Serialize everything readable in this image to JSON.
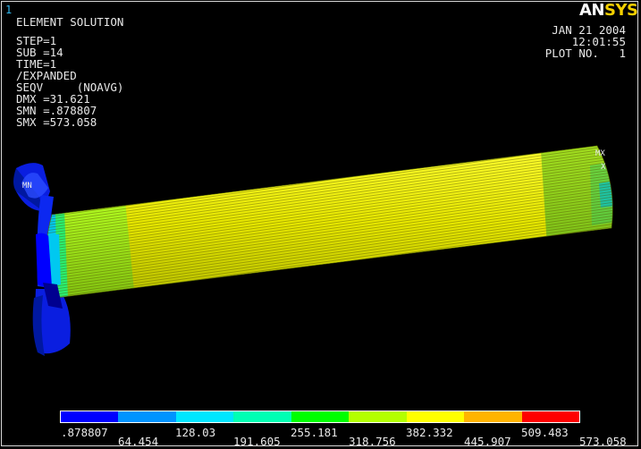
{
  "window_number": "1",
  "brand": {
    "part1": "AN",
    "part2": "SYS"
  },
  "header_left": [
    "ELEMENT SOLUTION",
    "",
    "STEP=1",
    "SUB =14",
    "TIME=1",
    "/EXPANDED",
    "SEQV     (NOAVG)",
    "DMX =31.621",
    "SMN =.878807",
    "SMX =573.058"
  ],
  "header_right": {
    "date": "JAN 21 2004",
    "time": "12:01:55",
    "plot": "PLOT NO.   1"
  },
  "markers": {
    "min": "MN",
    "max": "MX"
  },
  "legend": {
    "colors": [
      "#0000ff",
      "#0094ff",
      "#00e6ff",
      "#00ffb4",
      "#00ff00",
      "#b4ff00",
      "#ffff00",
      "#ffb400",
      "#ff0000"
    ],
    "labels_top_row": [
      ".878807",
      "128.03",
      "255.181",
      "382.332",
      "509.483"
    ],
    "labels_bottom_row": [
      "64.454",
      "191.605",
      "318.756",
      "445.907",
      "573.058"
    ]
  }
}
